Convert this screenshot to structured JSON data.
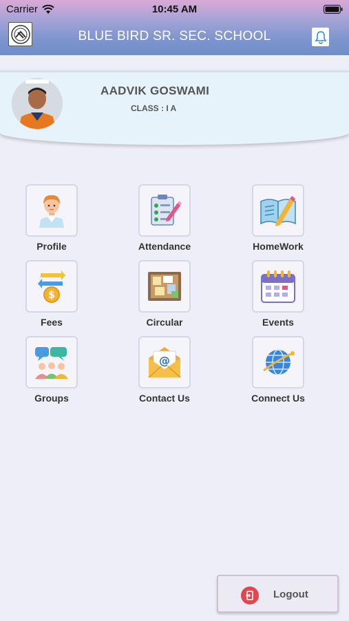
{
  "status_bar": {
    "carrier": "Carrier",
    "time": "10:45 AM"
  },
  "header": {
    "school_name": "BLUE BIRD SR. SEC. SCHOOL",
    "background_gradient": [
      "#d9a9d6",
      "#6f8dc8"
    ]
  },
  "student": {
    "name": "AADVIK GOSWAMI",
    "class_text": "CLASS : I A"
  },
  "menu": [
    {
      "label": "Profile",
      "icon": "profile-icon"
    },
    {
      "label": "Attendance",
      "icon": "attendance-icon"
    },
    {
      "label": "HomeWork",
      "icon": "homework-icon"
    },
    {
      "label": "Fees",
      "icon": "fees-icon"
    },
    {
      "label": "Circular",
      "icon": "circular-icon"
    },
    {
      "label": "Events",
      "icon": "events-icon"
    },
    {
      "label": "Groups",
      "icon": "groups-icon"
    },
    {
      "label": "Contact Us",
      "icon": "contact-us-icon"
    },
    {
      "label": "Connect Us",
      "icon": "connect-us-icon"
    }
  ],
  "logout": {
    "label": "Logout",
    "icon": "logout-icon",
    "accent": "#e0474f"
  }
}
